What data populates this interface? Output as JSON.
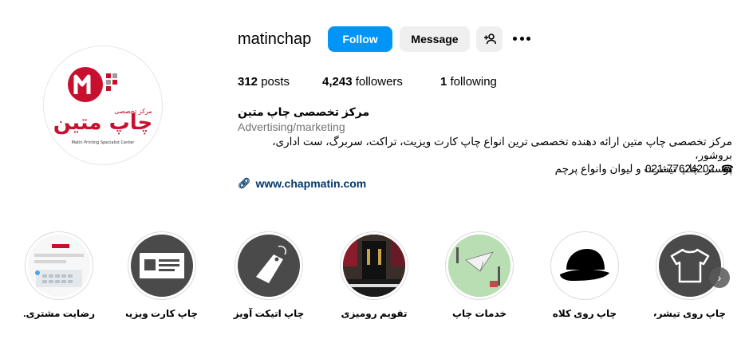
{
  "profile": {
    "username": "matinchap",
    "follow_label": "Follow",
    "message_label": "Message",
    "posts_count": "312",
    "posts_label": "posts",
    "followers_count": "4,243",
    "followers_label": "followers",
    "following_count": "1",
    "following_label": "following",
    "full_name": "مرکز تخصصی چاپ متین",
    "category": "Advertising/marketing",
    "bio_line1": "مرکز تخصصی چاپ متین ارائه دهنده تخصصی ترین انواع چاپ کارت ویزیت، تراکت، سربرگ، ست اداری، بروشور،",
    "bio_line2": "پوستر، چاپ تیشرت و لیوان وانواع پرچم",
    "phone": "021-77624202",
    "website": "www.chapmatin.com"
  },
  "logo": {
    "text_fa": "چاپ متین",
    "text_small": "مرکز تخصصی",
    "text_en": "Matin Printing Specialist Center",
    "primary_color": "#c8102e"
  },
  "highlights": [
    {
      "label": "رضایت مشتری...",
      "icon": "chat-screenshot-image"
    },
    {
      "label": "چاپ کارت ویزیت",
      "icon": "business-card-icon"
    },
    {
      "label": "چاپ اتیکت آویز",
      "icon": "price-tag-icon"
    },
    {
      "label": "تقویم رومیزی",
      "icon": "desk-calendar-image"
    },
    {
      "label": "خدمات چاپ",
      "icon": "printing-services-image"
    },
    {
      "label": "چاپ روی کلاه",
      "icon": "cap-icon"
    },
    {
      "label": "چاپ روی تیشرت",
      "icon": "tshirt-icon"
    }
  ],
  "colors": {
    "follow_button": "#0095f6",
    "secondary_button": "#efefef",
    "link": "#00376b",
    "highlight_dark": "#4a4a4a"
  }
}
